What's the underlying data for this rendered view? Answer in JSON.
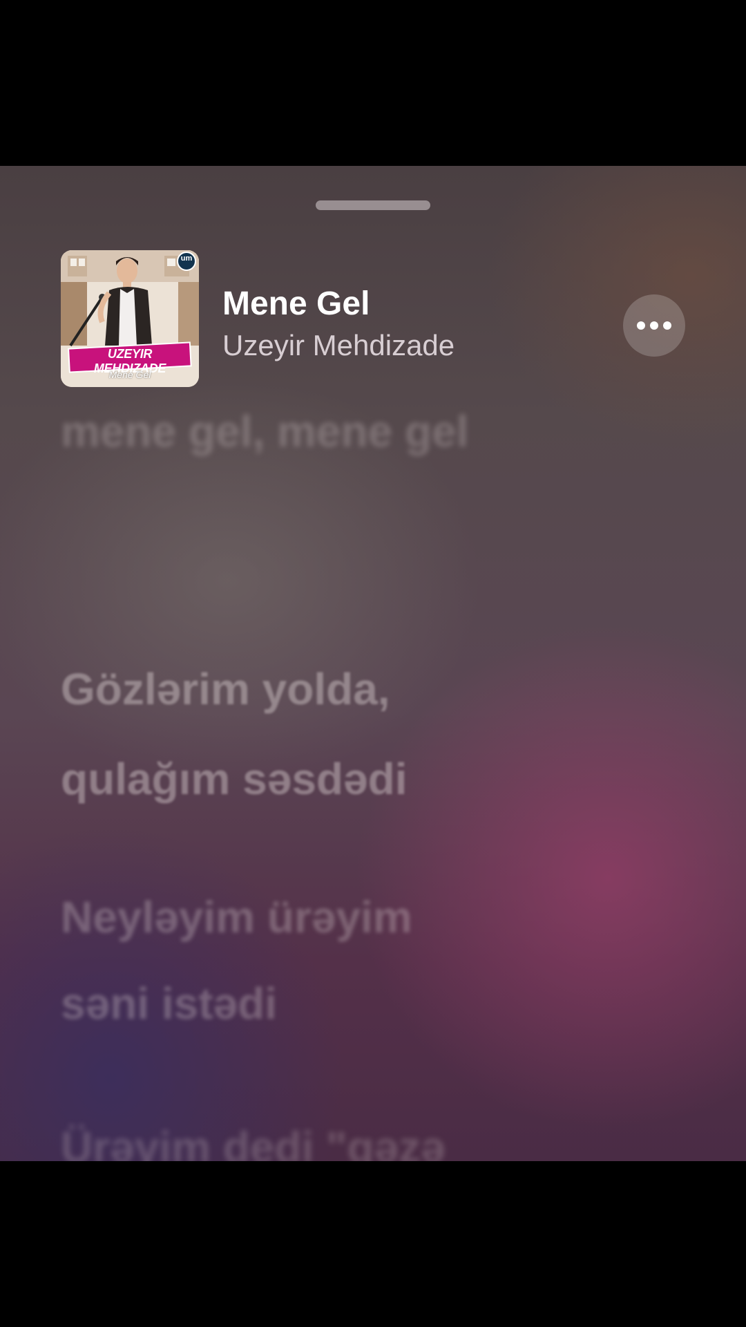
{
  "now_playing": {
    "title": "Mene Gel",
    "artist": "Uzeyir Mehdizade",
    "artwork": {
      "text": "UZEYIR MEHDIZADE",
      "subtitle": "Mene Gel",
      "badge": "um"
    },
    "more_icon": "ellipsis-icon"
  },
  "lyrics": {
    "previous": "mene gel, mene gel",
    "current": [
      "Gözlərim yolda,",
      "qulağım səsdədi"
    ],
    "upcoming": [
      "Neyləyim ürəyim",
      "səni istədi",
      "Ürəyim dedi \"gəzə"
    ]
  },
  "colors": {
    "accent_pink": "#c8127c",
    "background_top": "#4a3f42",
    "background_bottom": "#4a2c45"
  }
}
